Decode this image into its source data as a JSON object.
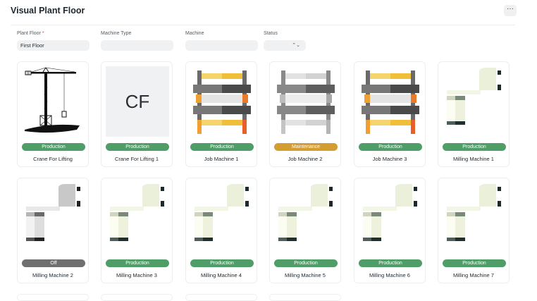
{
  "page": {
    "title": "Visual Plant Floor",
    "more_label": "···"
  },
  "filters": {
    "plant_floor": {
      "label": "Plant Floor",
      "required_mark": "*",
      "value": "First Floor"
    },
    "machine_type": {
      "label": "Machine Type",
      "value": ""
    },
    "machine": {
      "label": "Machine",
      "value": ""
    },
    "status": {
      "label": "Status",
      "value": "",
      "arrows": "⌃⌄"
    }
  },
  "cards": [
    {
      "name": "Crane For Lifting",
      "status": "Production",
      "status_kind": "production",
      "image": "crane"
    },
    {
      "name": "Crane For Lifting 1",
      "status": "Production",
      "status_kind": "production",
      "image": "initials",
      "initials": "CF"
    },
    {
      "name": "Job Machine 1",
      "status": "Production",
      "status_kind": "production",
      "image": "job-color"
    },
    {
      "name": "Job Machine 2",
      "status": "Maintenance",
      "status_kind": "maintenance",
      "image": "job-gray"
    },
    {
      "name": "Job Machine 3",
      "status": "Production",
      "status_kind": "production",
      "image": "job-color"
    },
    {
      "name": "Milling Machine 1",
      "status": "Production",
      "status_kind": "production",
      "image": "mill-color"
    },
    {
      "name": "Milling Machine 2",
      "status": "Off",
      "status_kind": "off",
      "image": "mill-gray"
    },
    {
      "name": "Milling Machine 3",
      "status": "Production",
      "status_kind": "production",
      "image": "mill-color"
    },
    {
      "name": "Milling Machine 4",
      "status": "Production",
      "status_kind": "production",
      "image": "mill-color"
    },
    {
      "name": "Milling Machine 5",
      "status": "Production",
      "status_kind": "production",
      "image": "mill-color"
    },
    {
      "name": "Milling Machine 6",
      "status": "Production",
      "status_kind": "production",
      "image": "mill-color"
    },
    {
      "name": "Milling Machine 7",
      "status": "Production",
      "status_kind": "production",
      "image": "mill-color"
    }
  ],
  "colors": {
    "production": "#4f9e68",
    "maintenance": "#d39d32",
    "off": "#6f6f6f"
  }
}
